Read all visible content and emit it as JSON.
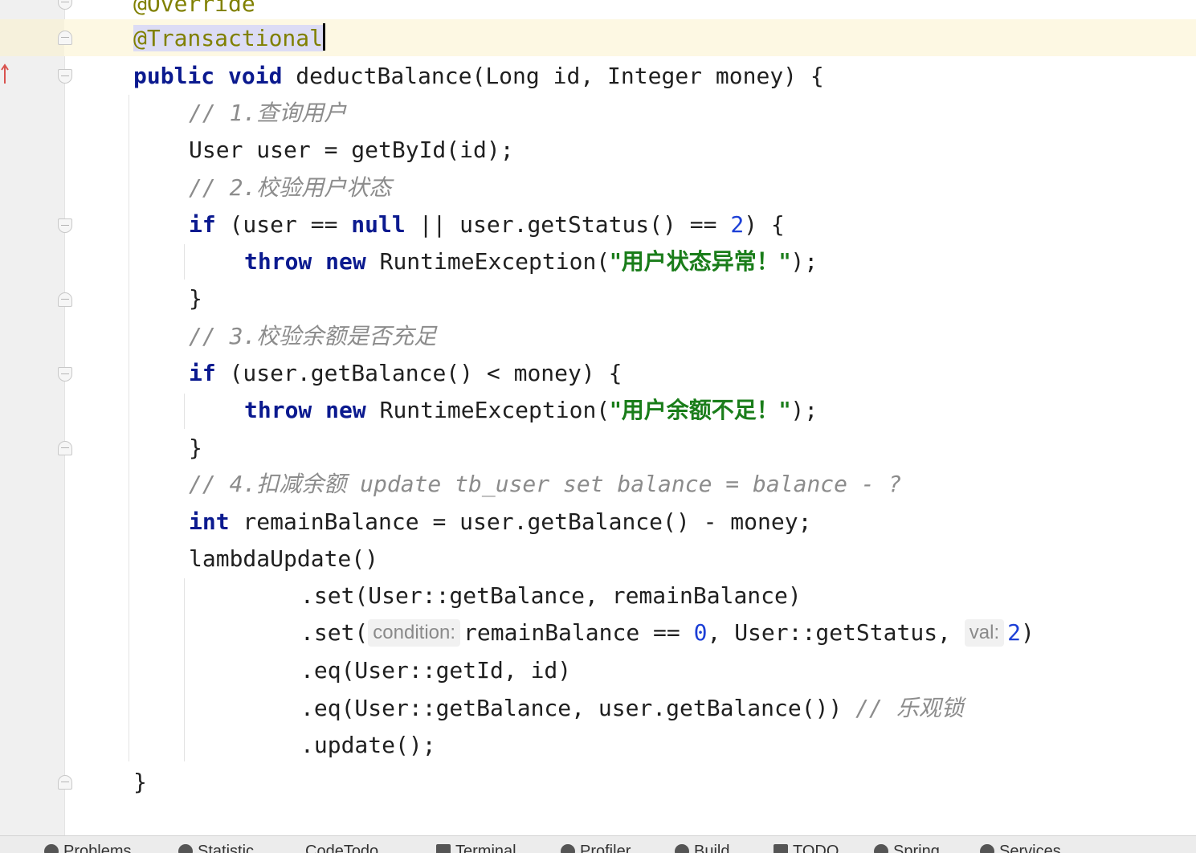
{
  "editor": {
    "lines": {
      "l0": {
        "text": "@Override"
      },
      "l1": {
        "annotation": "@Transactional"
      },
      "l2": {
        "kw1": "public",
        "kw2": "void",
        "rest": " deductBalance(Long id, Integer money) {"
      },
      "l3": {
        "comment": "// 1.查询用户"
      },
      "l4": {
        "text": "User user = getById(id);"
      },
      "l5": {
        "comment": "// 2.校验用户状态"
      },
      "l6": {
        "kw_if": "if",
        "a": " (user == ",
        "kw_null": "null",
        "b": " || user.getStatus() == ",
        "num": "2",
        "c": ") {"
      },
      "l7": {
        "kw_throw": "throw",
        "kw_new": "new",
        "a": " RuntimeException(",
        "str": "\"用户状态异常！\"",
        "b": ");"
      },
      "l8": {
        "text": "}"
      },
      "l9": {
        "comment": "// 3.校验余额是否充足"
      },
      "l10": {
        "kw_if": "if",
        "rest": " (user.getBalance() < money) {"
      },
      "l11": {
        "kw_throw": "throw",
        "kw_new": "new",
        "a": " RuntimeException(",
        "str": "\"用户余额不足！\"",
        "b": ");"
      },
      "l12": {
        "text": "}"
      },
      "l13": {
        "comment": "// 4.扣减余额 update tb_user set balance = balance - ?"
      },
      "l14": {
        "kw_int": "int",
        "rest": " remainBalance = user.getBalance() - money;"
      },
      "l15": {
        "text": "lambdaUpdate()"
      },
      "l16": {
        "text": ".set(User::getBalance, remainBalance)"
      },
      "l17": {
        "a": ".set(",
        "hint1": "condition:",
        "b": "remainBalance == ",
        "num1": "0",
        "c": ", User::getStatus, ",
        "hint2": "val:",
        "num2": "2",
        "d": ")"
      },
      "l18": {
        "text": ".eq(User::getId, id)"
      },
      "l19": {
        "code": ".eq(User::getBalance, user.getBalance()) ",
        "comment": "// 乐观锁"
      },
      "l20": {
        "text": ".update();"
      },
      "l21": {
        "text": "}"
      }
    }
  },
  "statusbar": {
    "items": [
      {
        "label": "Problems"
      },
      {
        "label": "Statistic"
      },
      {
        "label": "CodeTodo"
      },
      {
        "label": "Terminal"
      },
      {
        "label": "Profiler"
      },
      {
        "label": "Build"
      },
      {
        "label": "TODO"
      },
      {
        "label": "Spring"
      },
      {
        "label": "Services"
      }
    ]
  },
  "colors": {
    "keyword": "#0b1a8f",
    "number": "#1c3fd6",
    "string": "#1a7d1a",
    "comment": "#8c8c8c",
    "annotation": "#808000",
    "caret_line": "#fdf8e3"
  }
}
